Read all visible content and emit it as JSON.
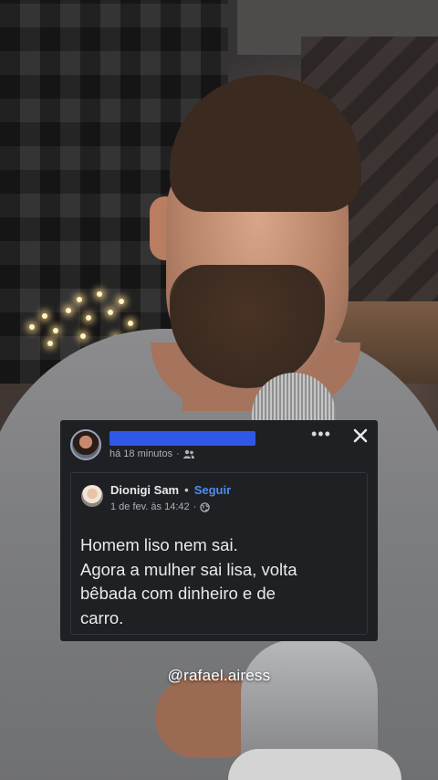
{
  "post": {
    "time_ago": "há 18 minutos",
    "shared": {
      "author": "Dionigi Sam",
      "separator": "•",
      "follow_label": "Seguir",
      "date": "1 de fev. às 14:42",
      "text_lines": [
        "Homem liso nem sai.",
        "Agora a mulher sai lisa, volta",
        "bêbada com dinheiro e de",
        "carro."
      ]
    },
    "icons": {
      "audience": "friends-icon",
      "privacy": "globe-icon",
      "more": "more-options-icon",
      "close": "close-icon"
    }
  },
  "watermark": {
    "handle": "@rafael.airess"
  },
  "colors": {
    "card_background": "#1f2024",
    "link_blue": "#4b8ef0",
    "redaction_blue": "#2f58e8"
  }
}
